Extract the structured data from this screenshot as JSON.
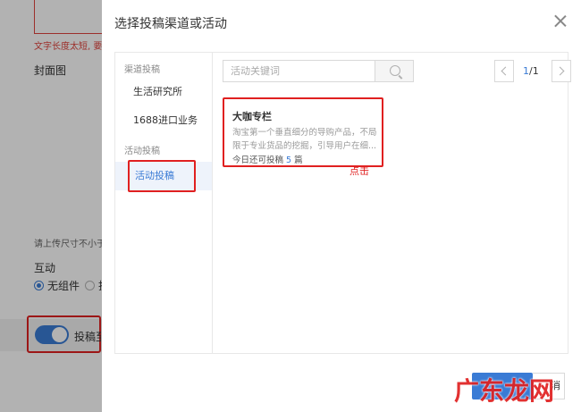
{
  "background": {
    "error_text": "文字长度太短, 要求",
    "cover_label": "封面图",
    "upload_hint": "请上传尺寸不小于",
    "interaction_label": "互动",
    "radio_options": [
      "无组件",
      "投"
    ],
    "toggle_label": "投稿至"
  },
  "modal": {
    "title": "选择投稿渠道或活动",
    "sidebar": {
      "channel_group": "渠道投稿",
      "channels": [
        "生活研究所",
        "1688进口业务"
      ],
      "activity_group": "活动投稿",
      "activities": [
        "活动投稿"
      ]
    },
    "search": {
      "placeholder": "活动关键词"
    },
    "pager": {
      "current": "1",
      "total": "/1"
    },
    "card": {
      "title": "大咖专栏",
      "desc_line1": "淘宝第一个垂直细分的导购产品，不局",
      "desc_line2": "限于专业货品的挖掘，引导用户在细...",
      "quota_prefix": "今日还可投稿",
      "quota_num": "5",
      "quota_suffix": "篇"
    },
    "click_note": "点击",
    "cancel_label": "消"
  },
  "watermark": "广东龙网",
  "colors": {
    "accent": "#3a7bd5",
    "highlight": "#e02020"
  }
}
